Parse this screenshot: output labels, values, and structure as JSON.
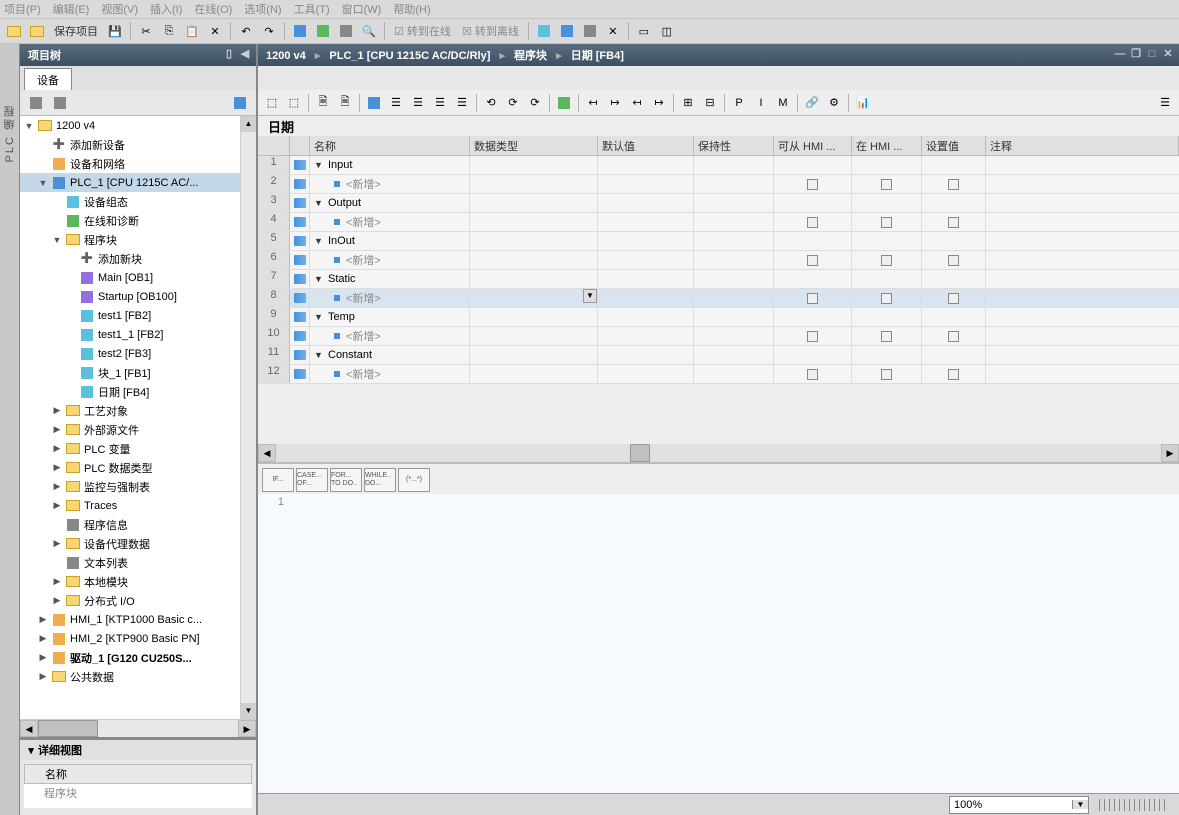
{
  "menu": {
    "items": [
      "项目(P)",
      "编辑(E)",
      "视图(V)",
      "插入(I)",
      "在线(O)",
      "选项(N)",
      "工具(T)",
      "窗口(W)",
      "帮助(H)"
    ]
  },
  "main_toolbar": {
    "save_label": "保存项目",
    "go_online": "转到在线",
    "go_offline": "转到离线"
  },
  "left_tab": {
    "label": "PLC 编程"
  },
  "project": {
    "title": "项目树",
    "device_tab": "设备",
    "root": "1200 v4",
    "add_device": "添加新设备",
    "devices_networks": "设备和网络",
    "plc": "PLC_1 [CPU 1215C AC/...",
    "device_config": "设备组态",
    "online_diag": "在线和诊断",
    "program_blocks": "程序块",
    "add_block": "添加新块",
    "main": "Main [OB1]",
    "startup": "Startup [OB100]",
    "test1": "test1 [FB2]",
    "test1_1": "test1_1 [FB2]",
    "test2": "test2 [FB3]",
    "block1": "块_1 [FB1]",
    "date_block": "日期 [FB4]",
    "tech_objects": "工艺对象",
    "ext_sources": "外部源文件",
    "plc_vars": "PLC 变量",
    "plc_types": "PLC 数据类型",
    "watch_force": "监控与强制表",
    "traces": "Traces",
    "prog_info": "程序信息",
    "device_proxy": "设备代理数据",
    "text_lists": "文本列表",
    "local_modules": "本地模块",
    "dist_io": "分布式 I/O",
    "hmi1": "HMI_1 [KTP1000 Basic c...",
    "hmi2": "HMI_2 [KTP900 Basic PN]",
    "drive": "驱动_1 [G120 CU250S...",
    "common_data": "公共数据"
  },
  "detail": {
    "title": "详细视图",
    "col_name": "名称",
    "row1": "程序块"
  },
  "breadcrumb": {
    "parts": [
      "1200 v4",
      "PLC_1 [CPU 1215C AC/DC/Rly]",
      "程序块",
      "日期 [FB4]"
    ]
  },
  "block": {
    "name": "日期"
  },
  "iface": {
    "headers": {
      "name": "名称",
      "type": "数据类型",
      "default": "默认值",
      "retain": "保持性",
      "hmi_from": "可从 HMI ...",
      "hmi_in": "在 HMI ...",
      "setpoint": "设置值",
      "comment": "注释"
    },
    "rows": [
      {
        "n": "1",
        "kind": "section",
        "label": "Input"
      },
      {
        "n": "2",
        "kind": "add",
        "label": "<新增>"
      },
      {
        "n": "3",
        "kind": "section",
        "label": "Output"
      },
      {
        "n": "4",
        "kind": "add",
        "label": "<新增>"
      },
      {
        "n": "5",
        "kind": "section",
        "label": "InOut"
      },
      {
        "n": "6",
        "kind": "add",
        "label": "<新增>"
      },
      {
        "n": "7",
        "kind": "section",
        "label": "Static"
      },
      {
        "n": "8",
        "kind": "add",
        "label": "<新增>",
        "selected": true,
        "dd": true
      },
      {
        "n": "9",
        "kind": "section",
        "label": "Temp"
      },
      {
        "n": "10",
        "kind": "add",
        "label": "<新增>"
      },
      {
        "n": "11",
        "kind": "section",
        "label": "Constant"
      },
      {
        "n": "12",
        "kind": "add",
        "label": "<新增>"
      }
    ]
  },
  "palette": {
    "items": [
      "IF...",
      "CASE... OF...",
      "FOR... TO DO..",
      "WHILE.. DO...",
      "(*...*)"
    ]
  },
  "code": {
    "line1": "1"
  },
  "status": {
    "zoom": "100%"
  }
}
